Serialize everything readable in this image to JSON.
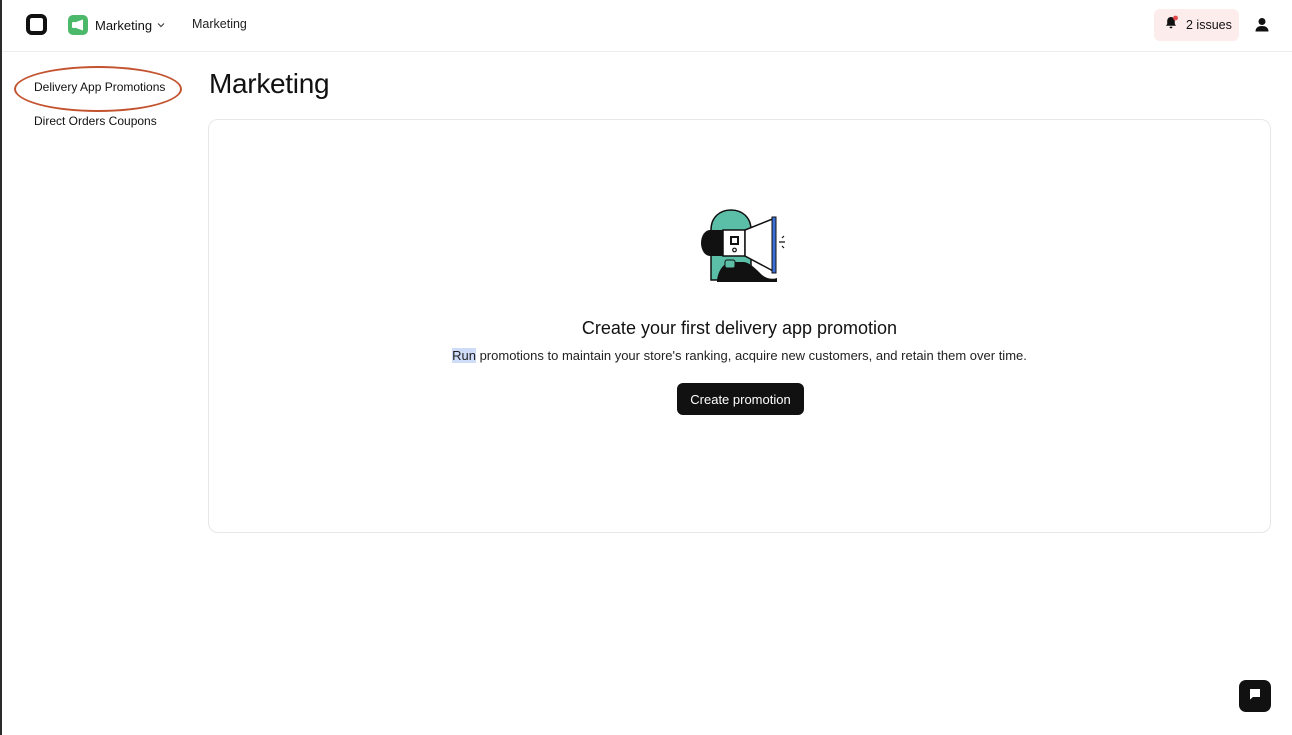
{
  "topbar": {
    "app_logo": "app-logo-icon",
    "module": {
      "name": "Marketing",
      "icon": "megaphone-icon",
      "icon_color": "#4cb86a"
    },
    "breadcrumb": "Marketing",
    "issues": {
      "label": "2 issues",
      "icon": "bell-icon",
      "badge_color": "#e5484d",
      "background": "#fdecec"
    },
    "profile_icon": "user-icon"
  },
  "sidebar": {
    "items": [
      {
        "label": "Delivery App Promotions",
        "active": true
      },
      {
        "label": "Direct Orders Coupons",
        "active": false
      }
    ],
    "annotation_color": "#c3532f"
  },
  "main": {
    "title": "Marketing",
    "empty_state": {
      "title": "Create your first delivery app promotion",
      "description_highlight": "Run",
      "description_rest": " promotions to maintain your store's ranking, acquire new customers, and retain them over time.",
      "button_label": "Create promotion",
      "illustration": "megaphone-illustration"
    }
  },
  "chat_button": {
    "icon": "chat-icon"
  }
}
